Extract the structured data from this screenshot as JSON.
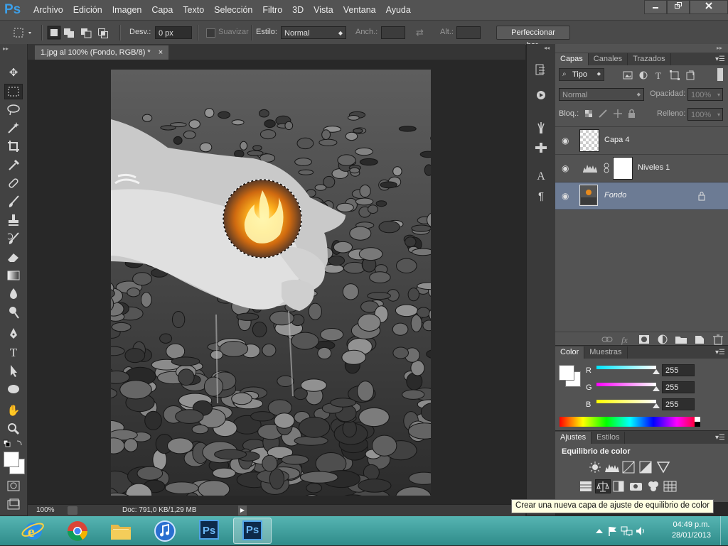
{
  "app": {
    "logo": "Ps"
  },
  "menu": [
    "Archivo",
    "Edición",
    "Imagen",
    "Capa",
    "Texto",
    "Selección",
    "Filtro",
    "3D",
    "Vista",
    "Ventana",
    "Ayuda"
  ],
  "options": {
    "feather_label": "Desv.:",
    "feather_value": "0 px",
    "antialias_label": "Suavizar",
    "style_label": "Estilo:",
    "style_value": "Normal",
    "width_label": "Anch.:",
    "height_label": "Alt.:",
    "refine_button": "Perfeccionar bor."
  },
  "document": {
    "tab_title": "1.jpg al 100% (Fondo, RGB/8) *",
    "close_glyph": "×",
    "zoom": "100%",
    "doc_info": "Doc: 791,0 KB/1,29 MB"
  },
  "layers_panel": {
    "tabs": [
      "Capas",
      "Canales",
      "Trazados"
    ],
    "filter_label": "Tipo",
    "blend_mode": "Normal",
    "opacity_label": "Opacidad:",
    "opacity_value": "100%",
    "lock_label": "Bloq.:",
    "fill_label": "Relleno:",
    "fill_value": "100%",
    "layers": [
      {
        "name": "Capa 4",
        "selected": false
      },
      {
        "name": "Niveles 1",
        "selected": false
      },
      {
        "name": "Fondo",
        "selected": true
      }
    ]
  },
  "color_panel": {
    "tabs": [
      "Color",
      "Muestras"
    ],
    "channels": [
      {
        "label": "R",
        "value": "255",
        "color": "#00e5ff"
      },
      {
        "label": "G",
        "value": "255",
        "color": "#ff00ff"
      },
      {
        "label": "B",
        "value": "255",
        "color": "#ffff00"
      }
    ]
  },
  "adjustments_panel": {
    "tabs": [
      "Ajustes",
      "Estilos"
    ],
    "heading": "Equilibrio de color",
    "tooltip": "Crear una nueva capa de ajuste de equilibrio de color"
  },
  "taskbar": {
    "ps_label": "Ps",
    "time": "04:49 p.m.",
    "date": "28/01/2013"
  },
  "colors": {
    "layer_selected": "#6c7b94",
    "taskbar": "#3fa1a0",
    "ps_blue": "#3d9fe8"
  }
}
